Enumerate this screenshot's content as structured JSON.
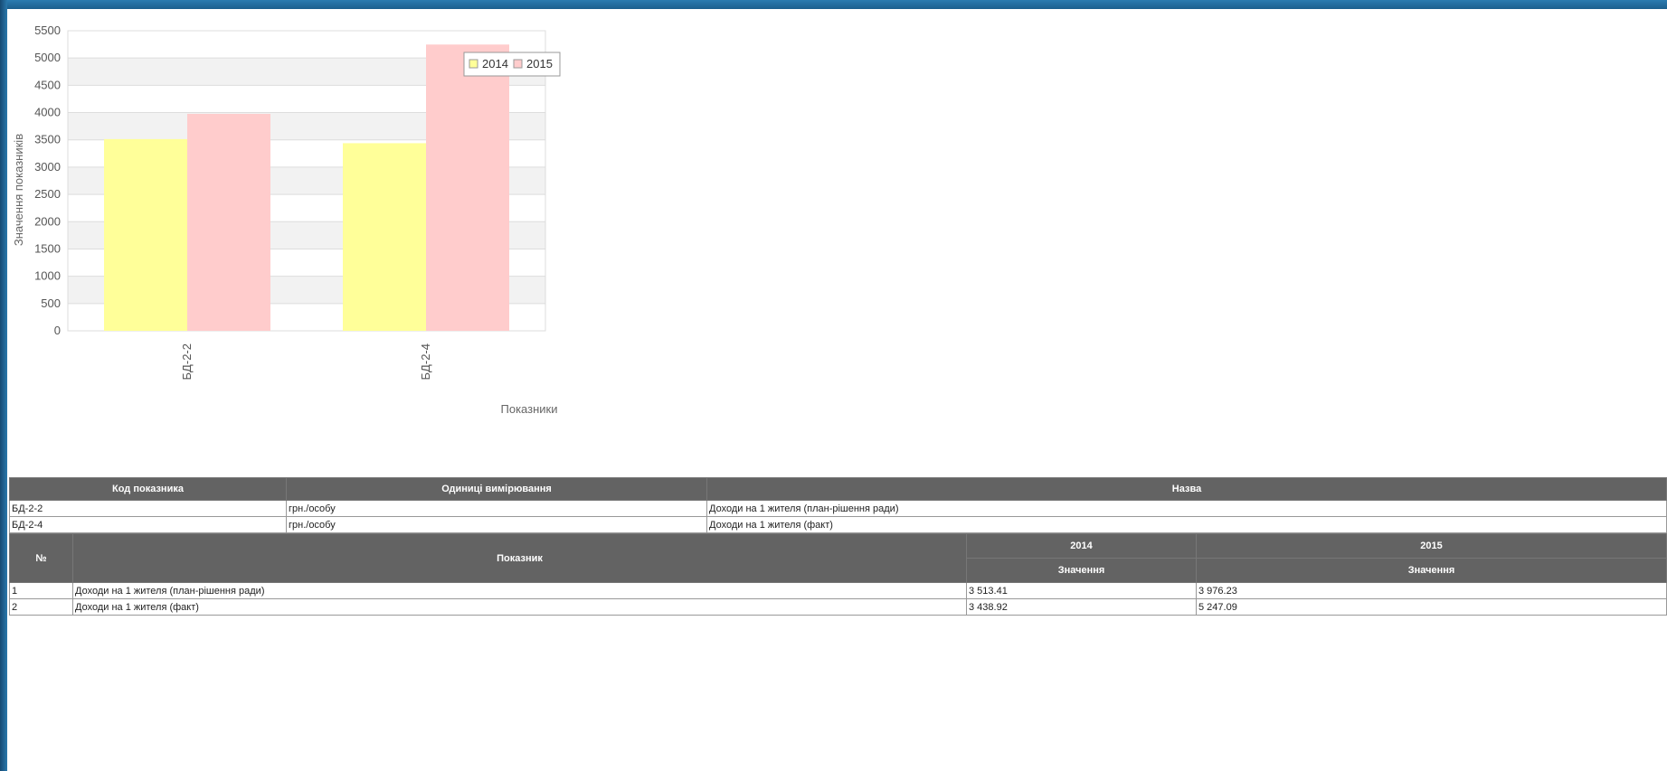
{
  "colors": {
    "series_2014": "#ffff99",
    "series_2015": "#ffcccc",
    "grid_band": "#f2f2f2",
    "header_bg": "#636363"
  },
  "chart_data": {
    "type": "bar",
    "categories": [
      "БД-2-2",
      "БД-2-4"
    ],
    "series": [
      {
        "name": "2014",
        "values": [
          3513.41,
          3438.92
        ]
      },
      {
        "name": "2015",
        "values": [
          3976.23,
          5247.09
        ]
      }
    ],
    "ylabel": "Значення показників",
    "xlabel": "Показники",
    "ylim": [
      0,
      5500
    ],
    "yticks": [
      0,
      500,
      1000,
      1500,
      2000,
      2500,
      3000,
      3500,
      4000,
      4500,
      5000,
      5500
    ],
    "legend_position": "top-right",
    "grid": true
  },
  "info_table": {
    "headers": [
      "Код показника",
      "Одиниці вимірювання",
      "Назва"
    ],
    "rows": [
      [
        "БД-2-2",
        "грн./особу",
        "Доходи на 1 жителя (план-рішення ради)"
      ],
      [
        "БД-2-4",
        "грн./особу",
        "Доходи на 1 жителя (факт)"
      ]
    ]
  },
  "values_table": {
    "header_num": "№",
    "header_indicator": "Показник",
    "year_2014": "2014",
    "year_2015": "2015",
    "sub_2014": "Значення",
    "sub_2015": "Значення",
    "rows": [
      [
        "1",
        "Доходи на 1 жителя (план-рішення ради)",
        "3 513.41",
        "3 976.23"
      ],
      [
        "2",
        "Доходи на 1 жителя (факт)",
        "3 438.92",
        "5 247.09"
      ]
    ]
  }
}
